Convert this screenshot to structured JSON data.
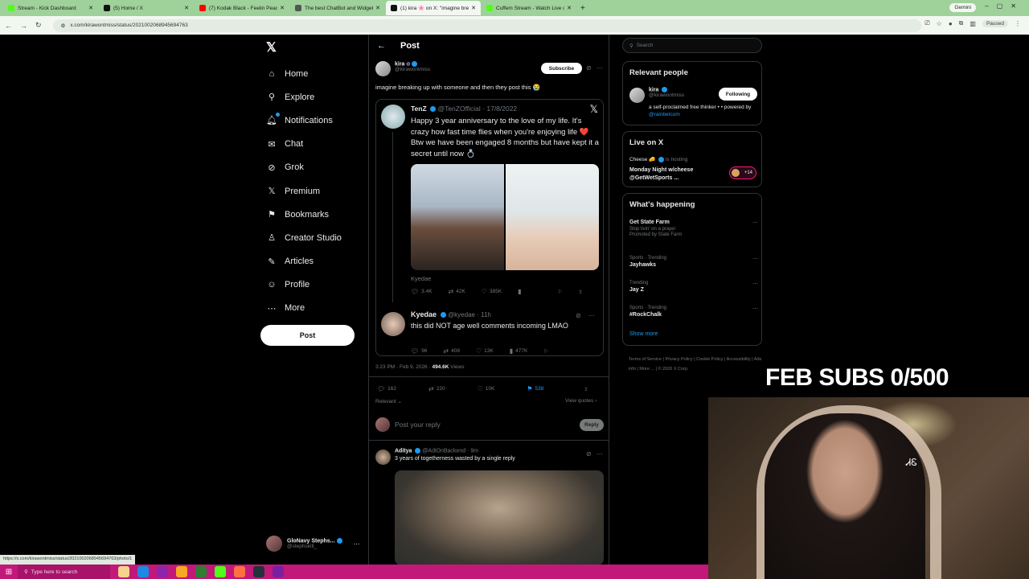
{
  "browser": {
    "tabs": [
      {
        "title": "Stream - Kick Dashboard",
        "color": "#53fc18",
        "active": false
      },
      {
        "title": "(5) Home / X",
        "color": "#111111",
        "active": false
      },
      {
        "title": "(7) Kodak Black - Feelin Peachy",
        "color": "#ff0000",
        "active": false
      },
      {
        "title": "The best ChatBot and Widgets",
        "color": "#555555",
        "active": false
      },
      {
        "title": "(1) kira 🌸 on X: \"imagine brea",
        "color": "#111111",
        "active": true
      },
      {
        "title": "Cuffem Stream - Watch Live on",
        "color": "#53fc18",
        "active": false
      }
    ],
    "new_tab": "+",
    "gemini_label": "Gemini",
    "url": "x.com/kirawontmiss/status/2021002068945694763",
    "paused_label": "Paused",
    "status_url": "https://x.com/kirawontmiss/status/2021002068945694763/photo/1"
  },
  "x_logo": "𝕏",
  "nav": {
    "items": [
      {
        "label": "Home",
        "icon": "⌂",
        "name": "home"
      },
      {
        "label": "Explore",
        "icon": "⚲",
        "name": "explore"
      },
      {
        "label": "Notifications",
        "icon": "🔔︎",
        "name": "notifications"
      },
      {
        "label": "Chat",
        "icon": "✉",
        "name": "chat"
      },
      {
        "label": "Grok",
        "icon": "⊘",
        "name": "grok"
      },
      {
        "label": "Premium",
        "icon": "𝕏",
        "name": "premium"
      },
      {
        "label": "Bookmarks",
        "icon": "⚑",
        "name": "bookmarks"
      },
      {
        "label": "Creator Studio",
        "icon": "♙",
        "name": "creator-studio"
      },
      {
        "label": "Articles",
        "icon": "✎",
        "name": "articles"
      },
      {
        "label": "Profile",
        "icon": "☺",
        "name": "profile"
      },
      {
        "label": "More",
        "icon": "⋯",
        "name": "more"
      }
    ],
    "post_button": "Post",
    "account_name": "GloNavy Stephs...",
    "account_handle": "@stephskill_"
  },
  "main": {
    "back_icon": "←",
    "title": "Post",
    "author_name": "kira",
    "author_handle": "@kirawontmiss",
    "subscribe_label": "Subscribe",
    "text": "imagine breaking up with someone and then they post this 😭",
    "quote": {
      "author": "TenZ",
      "handle_date": "@TenZOfficial · 17/8/2022",
      "text": "Happy 3 year anniversary to the love of my life. It's crazy how fast time flies when you're enjoying life ❤️ Btw we have been engaged 8 months but have kept it a secret until now 💍",
      "caption": "Kyedae",
      "stats": [
        "3.4K",
        "42K",
        "385K"
      ],
      "reply": {
        "author": "Kyedae",
        "handle_time": "@kyedae · 11h",
        "text": "this did NOT age well comments incoming LMAO",
        "stats": [
          "96",
          "408",
          "13K",
          "477K"
        ]
      }
    },
    "meta_time": "3:23 PM · Feb 9, 2026 · ",
    "meta_views": "494.6K",
    "meta_views_label": " Views",
    "stats": [
      "162",
      "220",
      "10K",
      "538"
    ],
    "relevant_label": "Relevant ⌄",
    "view_quotes_label": "View quotes ›",
    "reply_placeholder": "Post your reply",
    "reply_button": "Reply",
    "reply3": {
      "author": "Aditya",
      "handle_time": "@AdiOnBackend · 9m",
      "text": "3 years of togetherness wasted by a single reply"
    }
  },
  "right": {
    "search_placeholder": "Search",
    "relevant_people_title": "Relevant people",
    "person_name": "kira",
    "person_handle": "@kirawontmiss",
    "following_label": "Following",
    "bio": "a self-proclaimed free thinker • • powered by ",
    "bio_link": "@rainbetcom",
    "live_title": "Live on X",
    "live_host": "Cheese 🧀",
    "live_hosting": "is hosting",
    "live_stream_title": "Monday Night w/cheese @GetWetSports ...",
    "live_count": "+14",
    "whats_happening_title": "What's happening",
    "trends": [
      {
        "category": "",
        "name": "Get State Farm",
        "sub": "Stop livin' on a prayer",
        "promo": "Promoted by State Farm"
      },
      {
        "category": "Sports · Trending",
        "name": "Jayhawks"
      },
      {
        "category": "Trending",
        "name": "Jay Z"
      },
      {
        "category": "Sports · Trending",
        "name": "#RockChalk"
      }
    ],
    "show_more": "Show more",
    "footer": "Terms of Service  |  Privacy Policy  |  Cookie Policy  |  Accessibility  |  Ads info  |  More ...  |  © 2026 X Corp."
  },
  "overlay": {
    "sub_goal": "FEB SUBS 0/500",
    "webcam_text": "ᏗᏋ"
  },
  "taskbar": {
    "start_icon": "⊞",
    "search_placeholder": "Type here to search",
    "apps": [
      "#f5d38a",
      "#1e88e5",
      "#8e24aa",
      "#f9a825",
      "#2e7d32",
      "#53fc18",
      "#ff7043",
      "#263238",
      "#7b1fa2"
    ]
  }
}
